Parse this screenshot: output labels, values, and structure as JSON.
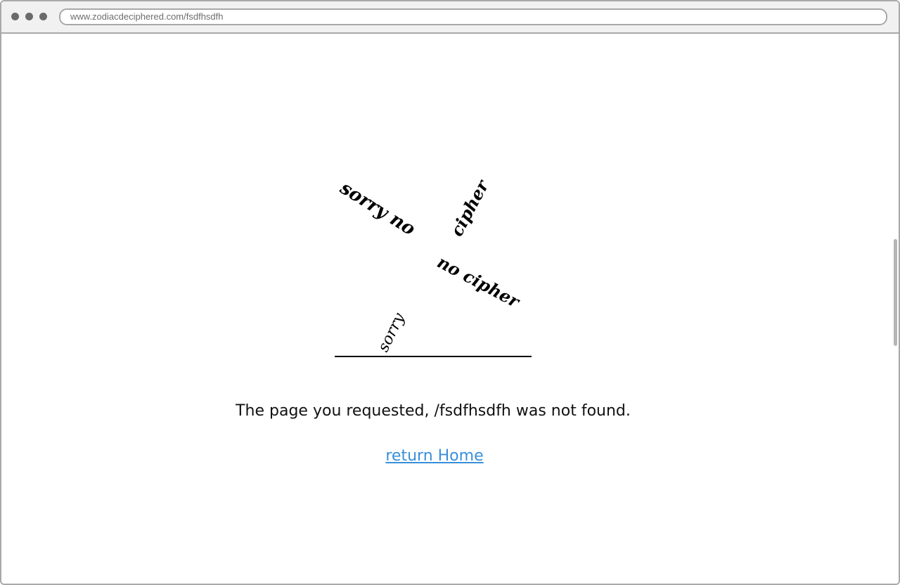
{
  "browser": {
    "url": "www.zodiacdeciphered.com/fsdfhsdfh"
  },
  "illustration": {
    "strokes": [
      {
        "text": "sorry no"
      },
      {
        "text": "cipher"
      },
      {
        "text": "no cipher"
      },
      {
        "text": "sorry"
      }
    ]
  },
  "main": {
    "message": "The page you requested, /fsdfhsdfh was not found.",
    "home_link": "return Home"
  }
}
